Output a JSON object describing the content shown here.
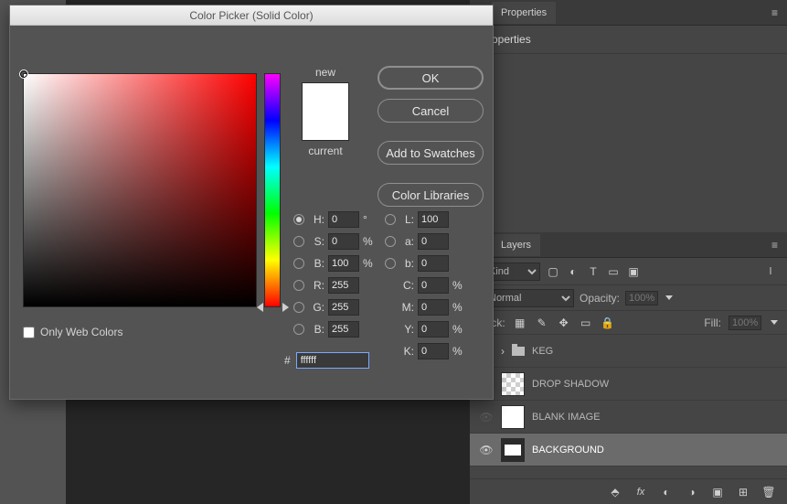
{
  "dialog": {
    "title": "Color Picker (Solid Color)",
    "new_label": "new",
    "current_label": "current",
    "ok": "OK",
    "cancel": "Cancel",
    "add_swatches": "Add to Swatches",
    "color_libraries": "Color Libraries",
    "only_web": "Only Web Colors",
    "fields": {
      "H": {
        "label": "H:",
        "value": "0",
        "unit": "°"
      },
      "S": {
        "label": "S:",
        "value": "0",
        "unit": "%"
      },
      "Bhsb": {
        "label": "B:",
        "value": "100",
        "unit": "%"
      },
      "R": {
        "label": "R:",
        "value": "255"
      },
      "G": {
        "label": "G:",
        "value": "255"
      },
      "Brgb": {
        "label": "B:",
        "value": "255"
      },
      "L": {
        "label": "L:",
        "value": "100"
      },
      "a": {
        "label": "a:",
        "value": "0"
      },
      "b": {
        "label": "b:",
        "value": "0"
      },
      "C": {
        "label": "C:",
        "value": "0",
        "unit": "%"
      },
      "M": {
        "label": "M:",
        "value": "0",
        "unit": "%"
      },
      "Y": {
        "label": "Y:",
        "value": "0",
        "unit": "%"
      },
      "K": {
        "label": "K:",
        "value": "0",
        "unit": "%"
      }
    },
    "hex_label": "#",
    "hex_value": "ffffff",
    "swatch_new": "#ffffff",
    "swatch_current": "#ffffff"
  },
  "properties": {
    "tab": "Properties",
    "heading": "Properties"
  },
  "layers": {
    "tab": "Layers",
    "filter_kind": "Kind",
    "blend_mode": "Normal",
    "opacity_label": "Opacity:",
    "opacity_value": "100%",
    "fill_label": "Fill:",
    "fill_value": "100%",
    "lock_label": "Lock:",
    "items": [
      {
        "name": "KEG",
        "type": "group",
        "visible": true,
        "expanded": false
      },
      {
        "name": "DROP SHADOW",
        "type": "layer",
        "visible": true,
        "thumb": "checker"
      },
      {
        "name": "BLANK IMAGE",
        "type": "layer",
        "visible": false,
        "thumb": "blank"
      },
      {
        "name": "BACKGROUND",
        "type": "fill",
        "visible": true,
        "thumb": "mon",
        "selected": true
      }
    ]
  },
  "icons": {
    "image": "▢",
    "circle": "◐",
    "type": "T",
    "shape": "▭",
    "smart": "▣",
    "artboard": "▥",
    "transparency": "▦",
    "brush": "✎",
    "move": "✥",
    "frame": "▭",
    "lock": "🔒",
    "link": "⬒",
    "fx": "fx",
    "mask": "◐",
    "folder": "📁",
    "new": "⊞",
    "trash": "🗑",
    "menu": "≡"
  }
}
